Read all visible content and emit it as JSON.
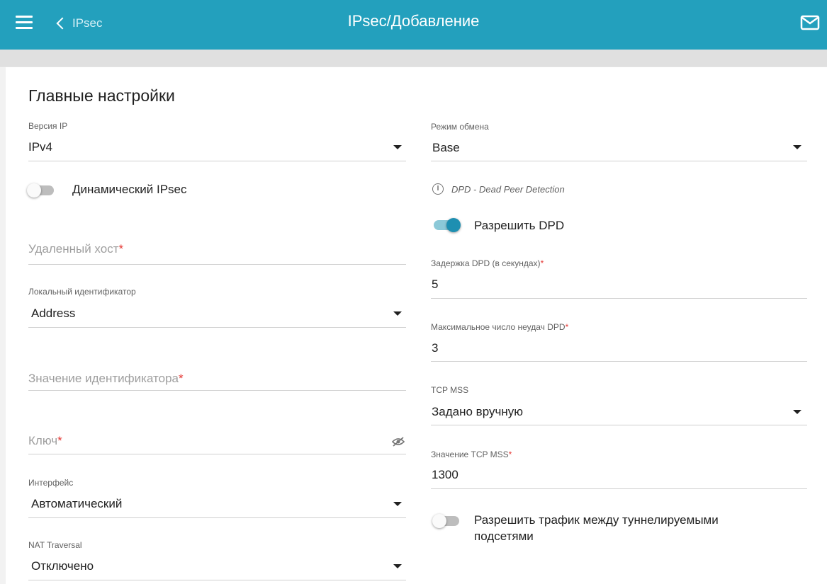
{
  "header": {
    "back_label": "IPsec",
    "title": "IPsec/Добавление"
  },
  "section_title": "Главные настройки",
  "left": {
    "ip_version": {
      "label": "Версия IP",
      "value": "IPv4"
    },
    "dynamic_ipsec": {
      "label": "Динамический IPsec",
      "enabled": false
    },
    "remote_host": {
      "placeholder": "Удаленный хост",
      "required_mark": "*"
    },
    "local_id": {
      "label": "Локальный идентификатор",
      "value": "Address"
    },
    "id_value": {
      "placeholder": "Значение идентификатора",
      "required_mark": "*"
    },
    "key": {
      "placeholder": "Ключ",
      "required_mark": "*"
    },
    "interface": {
      "label": "Интерфейс",
      "value": "Автоматический"
    },
    "nat_traversal": {
      "label": "NAT Traversal",
      "value": "Отключено"
    }
  },
  "right": {
    "exchange_mode": {
      "label": "Режим обмена",
      "value": "Base"
    },
    "dpd_info": "DPD - Dead Peer Detection",
    "allow_dpd": {
      "label": "Разрешить DPD",
      "enabled": true
    },
    "dpd_delay": {
      "label": "Задержка DPD (в секундах)",
      "required_mark": "*",
      "value": "5"
    },
    "dpd_failures": {
      "label": "Максимальное число неудач DPD",
      "required_mark": "*",
      "value": "3"
    },
    "tcp_mss": {
      "label": "TCP MSS",
      "value": "Задано вручную"
    },
    "tcp_mss_value": {
      "label": "Значение TCP MSS",
      "required_mark": "*",
      "value": "1300"
    },
    "allow_traffic": {
      "label_line1": "Разрешить трафик между туннелируемыми",
      "label_line2": "подсетями",
      "enabled": false
    }
  },
  "colors": {
    "accent": "#23a0bd",
    "toggle_on": "#1e8fb1",
    "required": "#e53935"
  }
}
